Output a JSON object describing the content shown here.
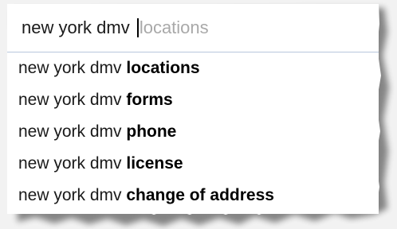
{
  "search": {
    "typed": "new york dmv ",
    "completion": "locations"
  },
  "suggestions": [
    {
      "prefix": "new york dmv ",
      "bold": "locations"
    },
    {
      "prefix": "new york dmv ",
      "bold": "forms"
    },
    {
      "prefix": "new york dmv ",
      "bold": "phone"
    },
    {
      "prefix": "new york dmv ",
      "bold": "license"
    },
    {
      "prefix": "new york dmv ",
      "bold": "change of address"
    }
  ],
  "colors": {
    "divider": "#b8c6dc",
    "completion": "#a9a9a9",
    "text": "#1a1a1a"
  }
}
